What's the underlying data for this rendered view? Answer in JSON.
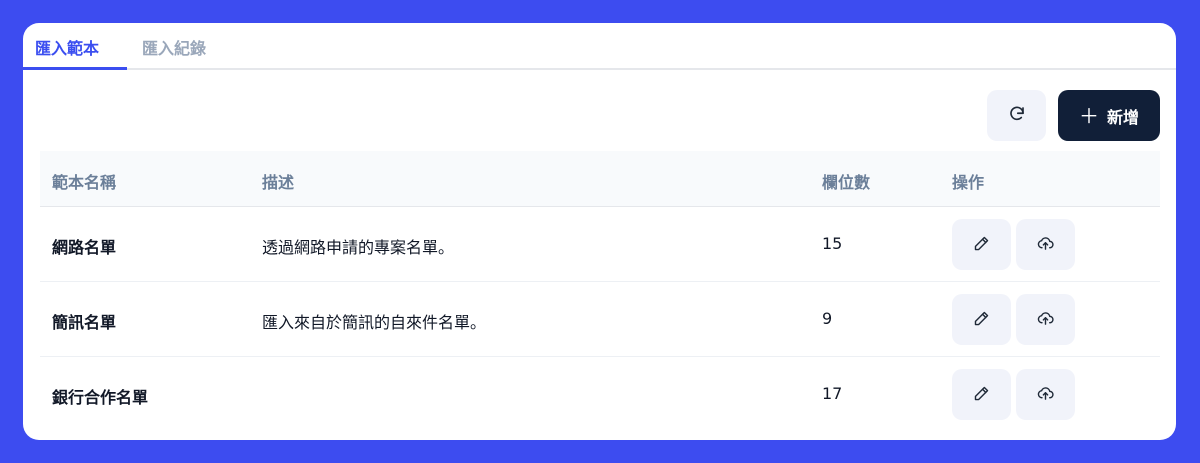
{
  "tabs": [
    {
      "label": "匯入範本",
      "active": true
    },
    {
      "label": "匯入紀錄",
      "active": false
    }
  ],
  "toolbar": {
    "refresh_icon": "refresh-icon",
    "add_icon": "plus-icon",
    "add_label": "新增"
  },
  "table": {
    "columns": [
      "範本名稱",
      "描述",
      "欄位數",
      "操作"
    ],
    "rows": [
      {
        "name": "網路名單",
        "description": "透過網路申請的專案名單。",
        "fields": "15"
      },
      {
        "name": "簡訊名單",
        "description": "匯入來自於簡訊的自來件名單。",
        "fields": "9"
      },
      {
        "name": "銀行合作名單",
        "description": "",
        "fields": "17"
      }
    ],
    "row_actions": [
      "edit-icon",
      "upload-icon"
    ]
  },
  "colors": {
    "background": "#3d4cf0",
    "accent": "#3b4ef0",
    "primary_button": "#111f38",
    "muted_text": "#6b7f99"
  }
}
